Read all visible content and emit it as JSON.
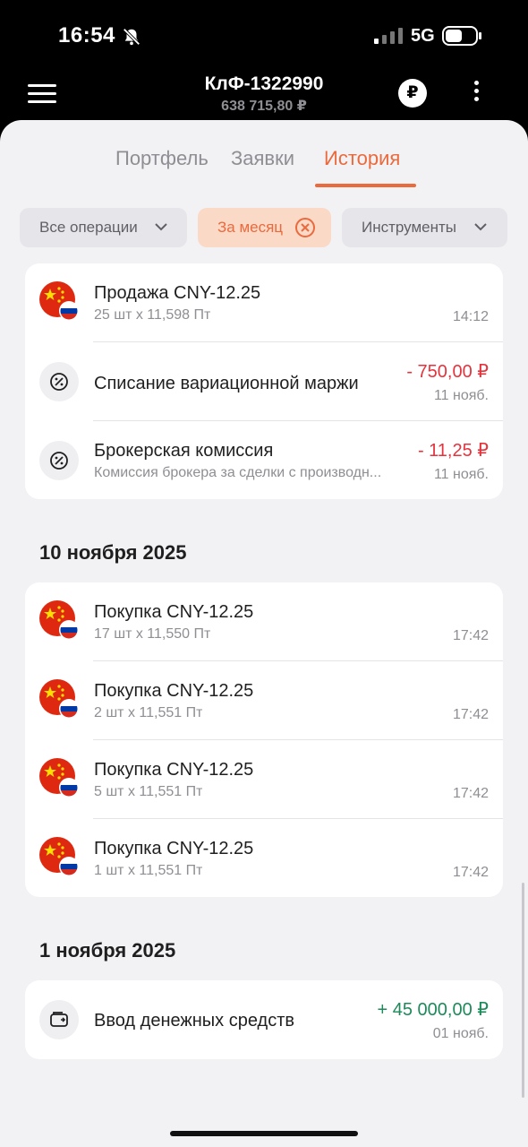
{
  "status_bar": {
    "time": "16:54",
    "network": "5G",
    "icons": [
      "bell-muted-icon",
      "signal-icon",
      "battery-icon"
    ]
  },
  "header": {
    "account": "КлФ-1322990",
    "balance": "638 715,80 ₽",
    "currency_symbol": "₽"
  },
  "tabs": [
    {
      "label": "Портфель",
      "active": false
    },
    {
      "label": "Заявки",
      "active": false
    },
    {
      "label": "История",
      "active": true
    }
  ],
  "filters": {
    "operations": "Все операции",
    "period": "За месяц",
    "instruments": "Инструменты"
  },
  "groups": [
    {
      "date": "",
      "items": [
        {
          "icon": "china-russia-flag-icon",
          "title": "Продажа CNY-12.25",
          "subtitle": "25 шт x 11,598 Пт",
          "amount": "",
          "time": "14:12"
        },
        {
          "icon": "percent-icon",
          "title": "Списание вариационной маржи",
          "subtitle": "",
          "amount": "- 750,00 ₽",
          "time": "11 нояб."
        },
        {
          "icon": "percent-icon",
          "title": "Брокерская комиссия",
          "subtitle": "Комиссия брокера за сделки с производн...",
          "amount": "- 11,25 ₽",
          "time": "11 нояб."
        }
      ]
    },
    {
      "date": "10 ноября 2025",
      "items": [
        {
          "icon": "china-russia-flag-icon",
          "title": "Покупка CNY-12.25",
          "subtitle": "17 шт x 11,550 Пт",
          "time": "17:42"
        },
        {
          "icon": "china-russia-flag-icon",
          "title": "Покупка CNY-12.25",
          "subtitle": "2 шт x 11,551 Пт",
          "time": "17:42"
        },
        {
          "icon": "china-russia-flag-icon",
          "title": "Покупка CNY-12.25",
          "subtitle": "5 шт x 11,551 Пт",
          "time": "17:42"
        },
        {
          "icon": "china-russia-flag-icon",
          "title": "Покупка CNY-12.25",
          "subtitle": "1 шт x 11,551 Пт",
          "time": "17:42"
        }
      ]
    },
    {
      "date": "1 ноября 2025",
      "items": [
        {
          "icon": "wallet-deposit-icon",
          "title": "Ввод денежных средств",
          "amount": "+ 45 000,00 ₽",
          "time": "01 нояб."
        }
      ]
    }
  ],
  "colors": {
    "accent": "#ea6a3d",
    "negative": "#e5333d",
    "positive": "#1d8a5a"
  }
}
